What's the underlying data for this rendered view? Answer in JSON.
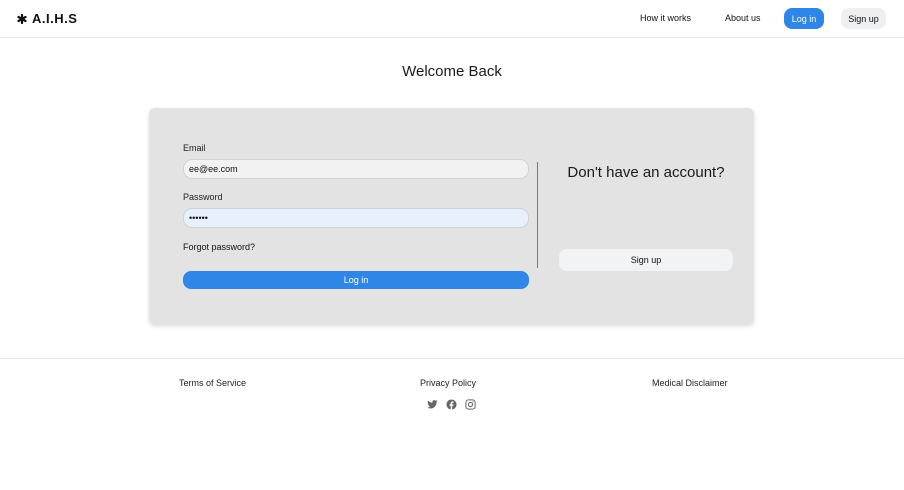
{
  "header": {
    "logo_text": "A.I.H.S",
    "logo_icon": "asterisk-icon",
    "nav": {
      "how_it_works": "How it works",
      "about_us": "About us",
      "login": "Log in",
      "signup": "Sign up"
    }
  },
  "main": {
    "title": "Welcome Back",
    "form": {
      "email_label": "Email",
      "email_value": "ee@ee.com",
      "password_label": "Password",
      "password_value": "••••••",
      "forgot_password": "Forgot password?",
      "login_button": "Log in"
    },
    "signup_panel": {
      "title": "Don't have an account?",
      "button": "Sign up"
    }
  },
  "footer": {
    "links": {
      "terms": "Terms of Service",
      "privacy": "Privacy Policy",
      "disclaimer": "Medical Disclaimer"
    },
    "social_icons": [
      "twitter-icon",
      "facebook-icon",
      "instagram-icon"
    ]
  },
  "colors": {
    "accent": "#2f86e6",
    "card_background": "#e3e3e3",
    "secondary_button": "#eeeff1"
  }
}
